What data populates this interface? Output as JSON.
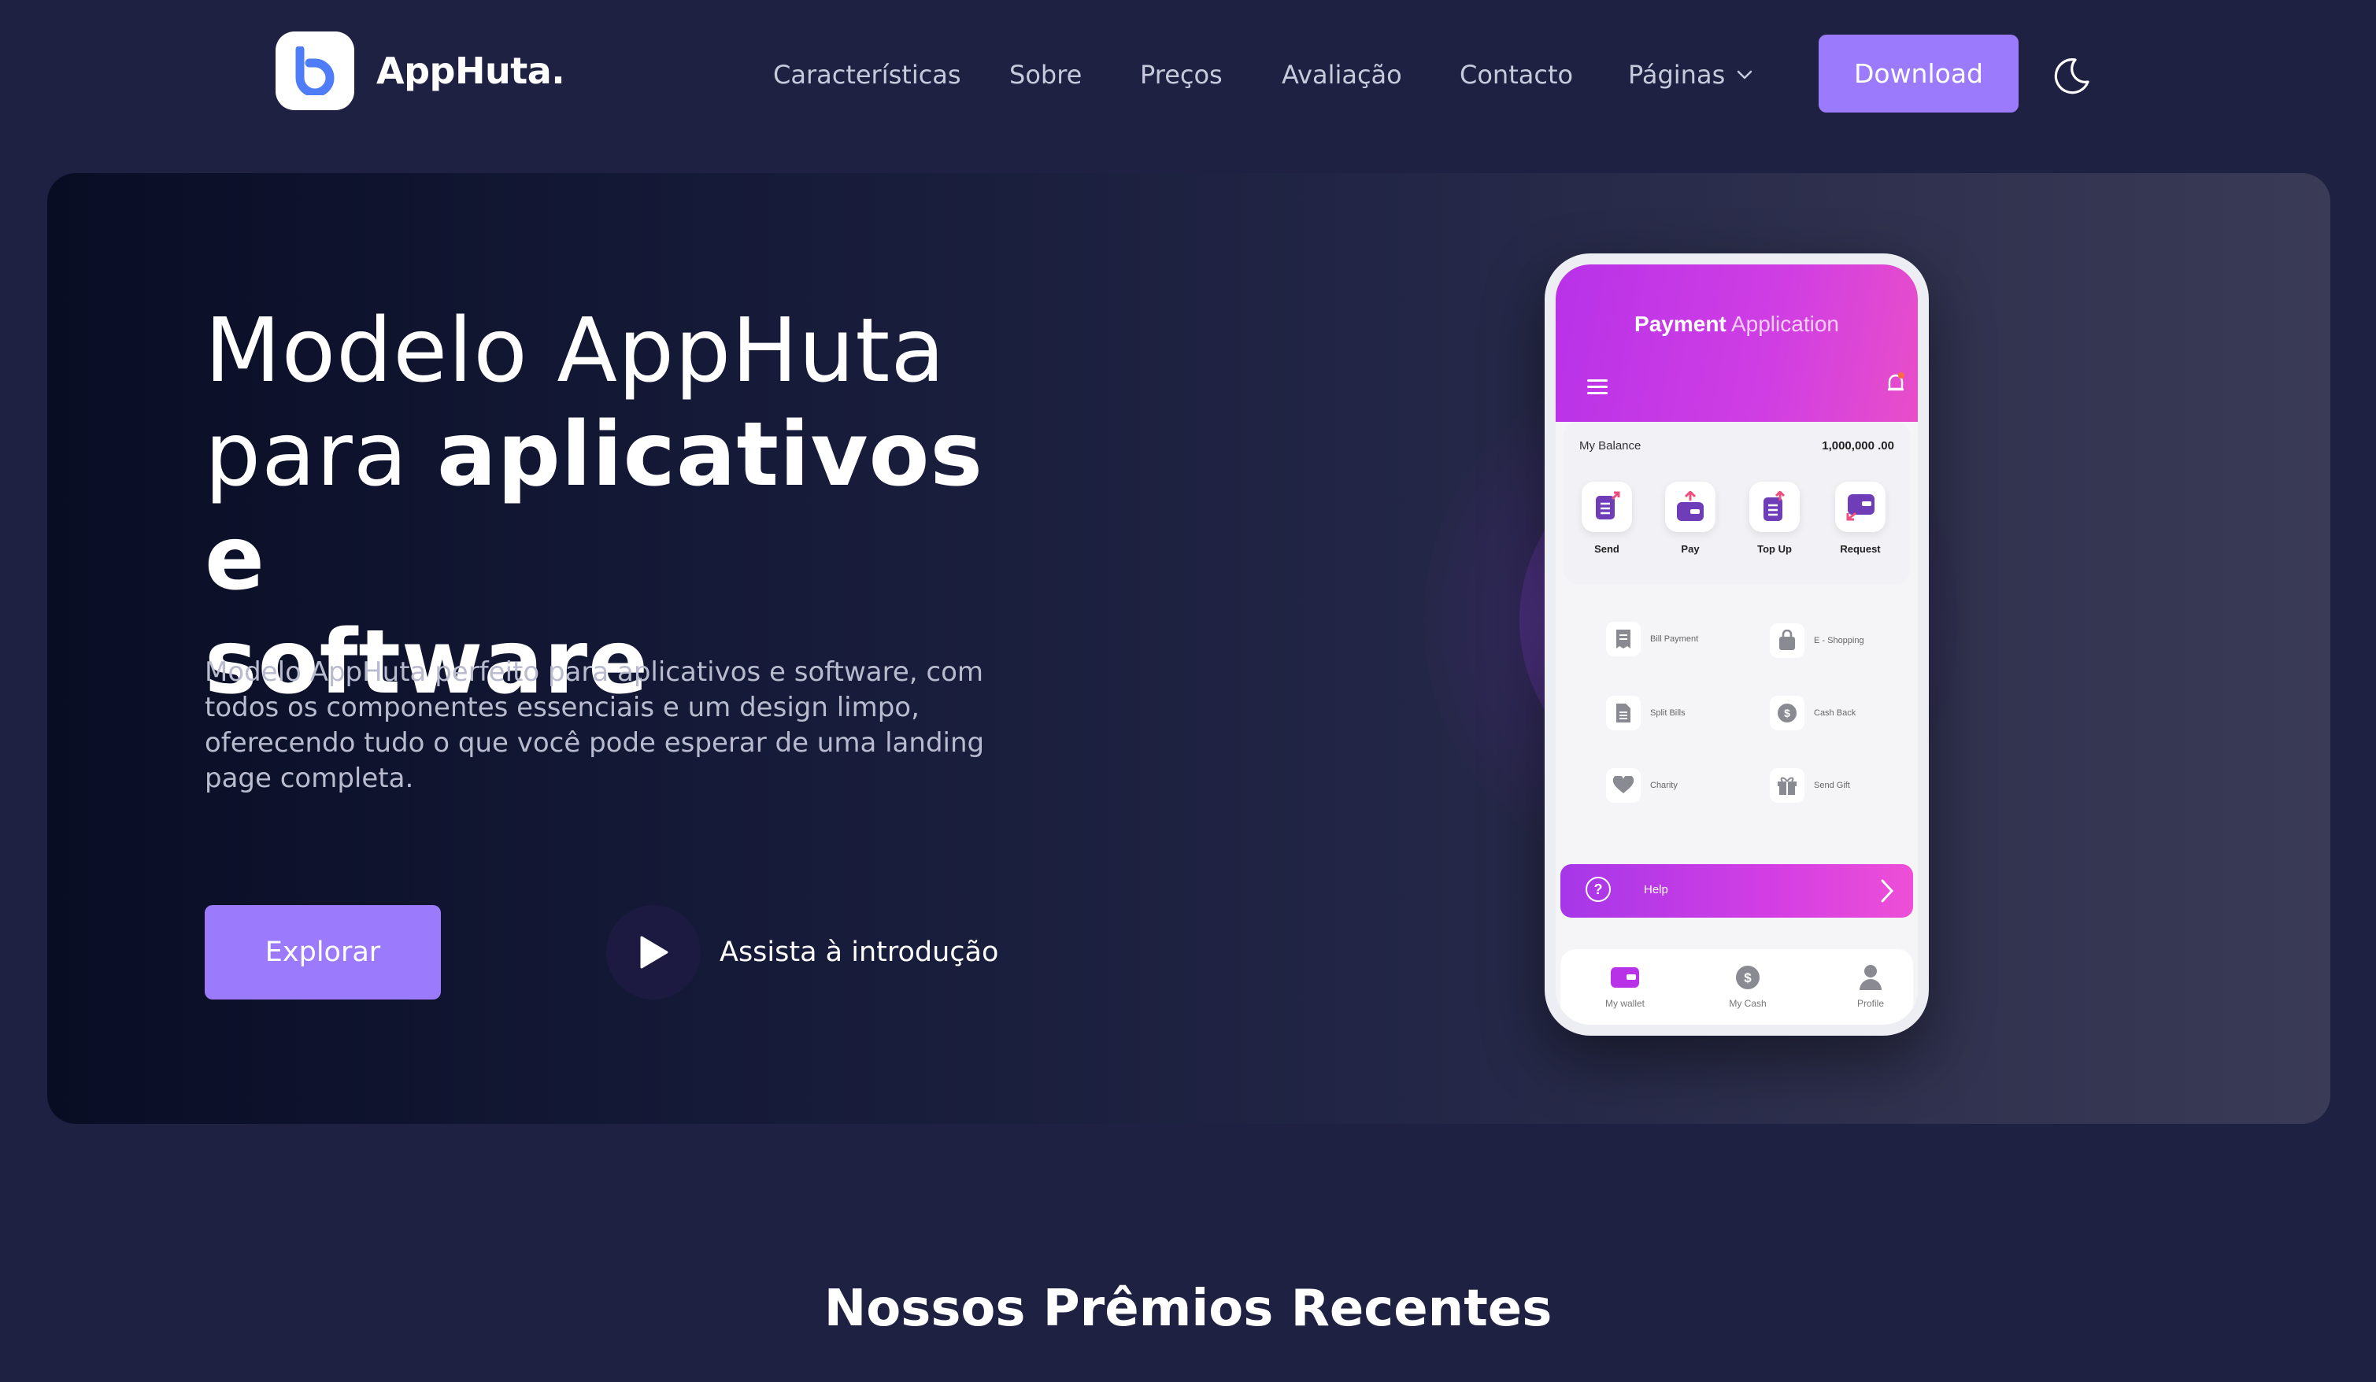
{
  "brand": {
    "name": "AppHuta."
  },
  "nav": {
    "items": [
      "Características",
      "Sobre",
      "Preços",
      "Avaliação",
      "Contacto",
      "Páginas"
    ],
    "download_label": "Download"
  },
  "hero": {
    "title_line1": "Modelo AppHuta",
    "title_line2_light": "para ",
    "title_line2_bold": "aplicativos e",
    "title_line3_bold": "software",
    "description": "Modelo AppHuta perfeito para aplicativos e software, com todos os componentes essenciais e um design limpo, oferecendo tudo o que você pode esperar de uma landing page completa.",
    "explore_label": "Explorar",
    "video_label": "Assista à introdução"
  },
  "phone": {
    "title_bold": "Payment",
    "title_light": "Application",
    "balance_label": "My Balance",
    "balance_value": "1,000,000 .00",
    "quick_actions": [
      "Send",
      "Pay",
      "Top Up",
      "Request"
    ],
    "services": [
      "Bill Payment",
      "E - Shopping",
      "Split Bills",
      "Cash Back",
      "Charity",
      "Send Gift"
    ],
    "help_label": "Help",
    "bottom_nav": [
      "My wallet",
      "My Cash",
      "Profile"
    ],
    "colors": {
      "accent": "#b832e8",
      "pink": "#ee4fd6"
    }
  },
  "awards": {
    "title": "Nossos Prêmios Recentes"
  },
  "colors": {
    "background": "#1f2142",
    "primary": "#9b7bfb"
  }
}
